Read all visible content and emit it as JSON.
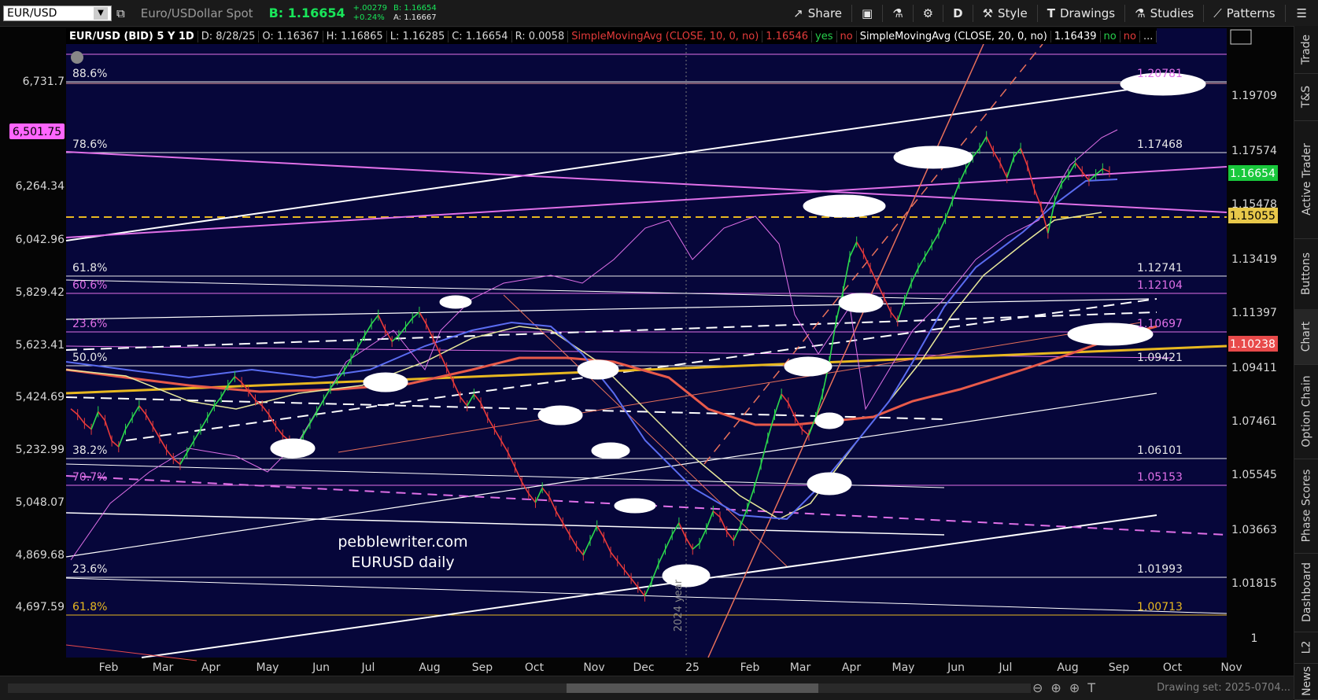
{
  "toolbar": {
    "symbol": "EUR/USD",
    "description": "Euro/USDollar Spot",
    "bid_label": "B: 1.16654",
    "change": "+.00279",
    "change_pct": "+0.24%",
    "bid_small": "B: 1.16654",
    "ask_small": "A: 1.16667",
    "share": "Share",
    "period": "D",
    "style": "Style",
    "drawings": "Drawings",
    "studies": "Studies",
    "patterns": "Patterns"
  },
  "header": {
    "symbol": "EUR/USD (BID) 5 Y 1D",
    "date": "D: 8/28/25",
    "open": "O: 1.16367",
    "high": "H: 1.16865",
    "low": "L: 1.16285",
    "close": "C: 1.16654",
    "range": "R: 0.0058",
    "sma10": "SimpleMovingAvg (CLOSE, 10, 0, no)",
    "sma10_val": "1.16546",
    "sma10_yes": "yes",
    "sma10_no": "no",
    "sma20": "SimpleMovingAvg (CLOSE, 20, 0, no)",
    "sma20_val": "1.16439",
    "sma20_no1": "no",
    "sma20_no2": "no",
    "more": "..."
  },
  "side_tabs": [
    "Trade",
    "T&S",
    "Active Trader",
    "Buttons",
    "Chart",
    "Option Chain",
    "Phase Scores",
    "Dashboard",
    "L2",
    "News"
  ],
  "bottom": {
    "drawing_set": "Drawing set: 2025-0704..."
  },
  "colors": {
    "background": "#06063a",
    "price_up": "#2bd94d",
    "price_down": "#e83a3a",
    "sma_blue": "#5a6cf0",
    "sma_yellow": "#e8e89a",
    "sma_red": "#e85a4a",
    "magenta": "#e070e8",
    "gold": "#e8b820"
  },
  "chart_data": {
    "type": "line",
    "title": "EUR/USD (BID) 5 Y 1D",
    "watermark": [
      "pebblewriter.com",
      "EURUSD daily"
    ],
    "x_axis_labels": [
      "Feb",
      "Mar",
      "Apr",
      "May",
      "Jun",
      "Jul",
      "Aug",
      "Sep",
      "Oct",
      "Nov",
      "Dec",
      "25",
      "Feb",
      "Mar",
      "Apr",
      "May",
      "Jun",
      "Jul",
      "Aug",
      "Sep",
      "Oct",
      "Nov"
    ],
    "year_marker": "2024 year",
    "right_axis_ticks": [
      "1.19709",
      "1.17574",
      "1.15478",
      "1.13419",
      "1.11397",
      "1.09411",
      "1.07461",
      "1.05545",
      "1.03663",
      "1.01815",
      "1"
    ],
    "left_axis_ticks": [
      "6,731.7",
      "6,501.75",
      "6,264.34",
      "6,042.96",
      "5,829.42",
      "5,623.41",
      "5,424.69",
      "5,232.99",
      "5,048.07",
      "4,869.68",
      "4,697.59"
    ],
    "left_axis_highlight": "6,501.75",
    "price_badges": [
      {
        "label": "1.16654",
        "color": "#19c83c"
      },
      {
        "label": "1.15055",
        "color": "#e8c84a"
      },
      {
        "label": "1.10238",
        "color": "#e84a4a"
      }
    ],
    "fib_levels_left": [
      {
        "label": "88.6%",
        "color": "#e8e8e8"
      },
      {
        "label": "78.6%",
        "color": "#e8e8e8"
      },
      {
        "label": "61.8%",
        "color": "#e8e8e8"
      },
      {
        "label": "60.6%",
        "color": "#e070e8"
      },
      {
        "label": "23.6%",
        "color": "#e070e8"
      },
      {
        "label": "50.0%",
        "color": "#e8e8e8"
      },
      {
        "label": "38.2%",
        "color": "#e8e8e8"
      },
      {
        "label": "70.7%",
        "color": "#e070e8"
      },
      {
        "label": "23.6%",
        "color": "#e8e8e8"
      },
      {
        "label": "61.8%",
        "color": "#e8b820"
      }
    ],
    "fib_levels_right": [
      {
        "label": "1.20781",
        "color": "#e070e8"
      },
      {
        "label": "1.17468",
        "color": "#e8e8e8"
      },
      {
        "label": "1.12741",
        "color": "#e8e8e8"
      },
      {
        "label": "1.12104",
        "color": "#e070e8"
      },
      {
        "label": "1.10697",
        "color": "#e070e8"
      },
      {
        "label": "1.09421",
        "color": "#e8e8e8"
      },
      {
        "label": "1.06101",
        "color": "#e8e8e8"
      },
      {
        "label": "1.05153",
        "color": "#e070e8"
      },
      {
        "label": "1.01993",
        "color": "#e8e8e8"
      },
      {
        "label": "1.00713",
        "color": "#e8b820"
      }
    ],
    "series": [
      {
        "name": "EUR/USD",
        "values": [
          1.085,
          1.083,
          1.08,
          1.078,
          1.084,
          1.081,
          1.074,
          1.072,
          1.078,
          1.082,
          1.086,
          1.083,
          1.079,
          1.075,
          1.071,
          1.068,
          1.066,
          1.07,
          1.074,
          1.078,
          1.082,
          1.086,
          1.089,
          1.093,
          1.096,
          1.094,
          1.091,
          1.088,
          1.086,
          1.083,
          1.079,
          1.076,
          1.074,
          1.072,
          1.076,
          1.08,
          1.084,
          1.088,
          1.092,
          1.095,
          1.098,
          1.102,
          1.106,
          1.11,
          1.114,
          1.117,
          1.112,
          1.108,
          1.11,
          1.113,
          1.116,
          1.118,
          1.114,
          1.109,
          1.104,
          1.099,
          1.094,
          1.089,
          1.086,
          1.09,
          1.087,
          1.082,
          1.078,
          1.074,
          1.07,
          1.065,
          1.06,
          1.056,
          1.053,
          1.058,
          1.055,
          1.05,
          1.046,
          1.042,
          1.038,
          1.035,
          1.04,
          1.045,
          1.041,
          1.036,
          1.033,
          1.03,
          1.027,
          1.024,
          1.021,
          1.026,
          1.032,
          1.037,
          1.042,
          1.046,
          1.041,
          1.037,
          1.039,
          1.044,
          1.05,
          1.048,
          1.043,
          1.04,
          1.045,
          1.051,
          1.058,
          1.066,
          1.075,
          1.083,
          1.09,
          1.087,
          1.082,
          1.078,
          1.076,
          1.082,
          1.09,
          1.101,
          1.115,
          1.125,
          1.137,
          1.142,
          1.138,
          1.133,
          1.128,
          1.123,
          1.118,
          1.115,
          1.122,
          1.128,
          1.133,
          1.137,
          1.141,
          1.145,
          1.15,
          1.156,
          1.162,
          1.167,
          1.171,
          1.174,
          1.178,
          1.173,
          1.169,
          1.164,
          1.171,
          1.174,
          1.168,
          1.16,
          1.154,
          1.145,
          1.156,
          1.162,
          1.165,
          1.169,
          1.166,
          1.163,
          1.165,
          1.167,
          1.166
        ]
      }
    ],
    "ylim": [
      1.0,
      1.215
    ]
  }
}
